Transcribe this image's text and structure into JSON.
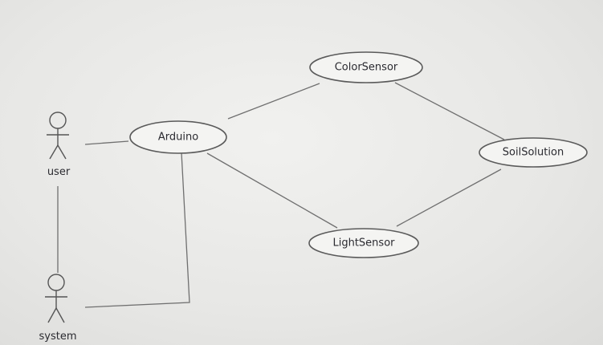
{
  "actors": {
    "user": {
      "label": "user"
    },
    "system": {
      "label": "system"
    }
  },
  "use_cases": {
    "arduino": {
      "label": "Arduino"
    },
    "color_sensor": {
      "label": "ColorSensor"
    },
    "soil_solution": {
      "label": "SoilSolution"
    },
    "light_sensor": {
      "label": "LightSensor"
    }
  }
}
